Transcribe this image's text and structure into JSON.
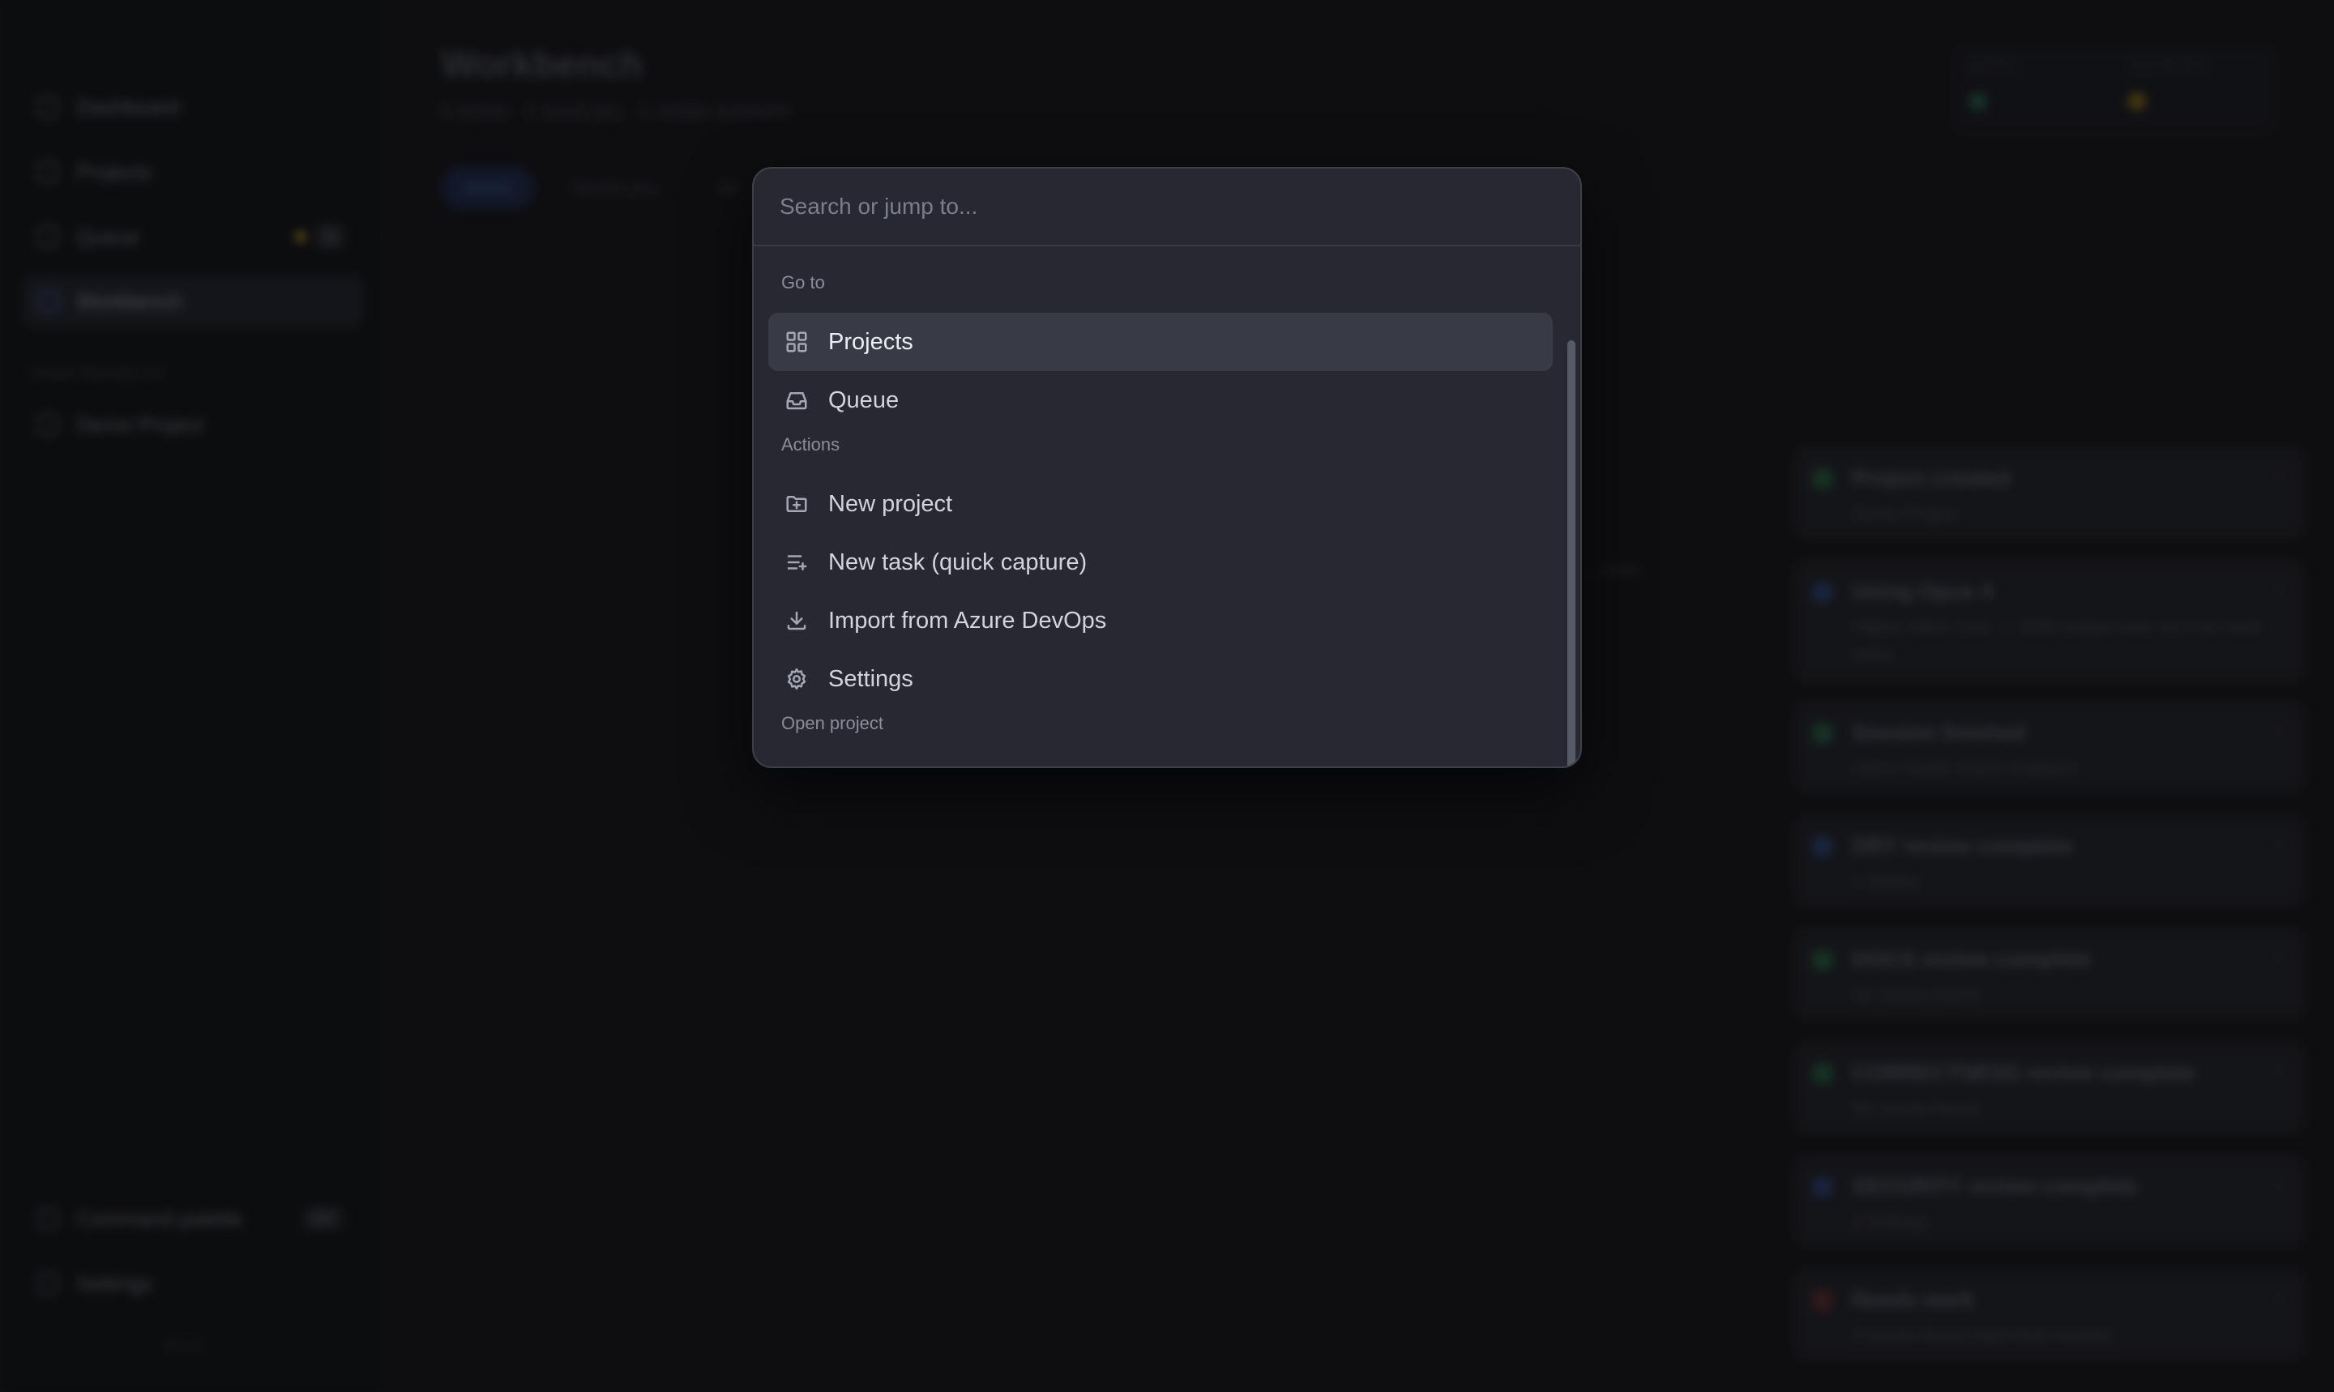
{
  "sidebar": {
    "items": [
      {
        "label": "Dashboard"
      },
      {
        "label": "Projects"
      },
      {
        "label": "Queue",
        "count": "3"
      },
      {
        "label": "Workbench"
      }
    ],
    "section_label": "YOUR PROJECTS",
    "projects": [
      {
        "label": "Demo Project"
      }
    ],
    "bottom": [
      {
        "label": "Command palette",
        "shortcut": "⌘K"
      },
      {
        "label": "Settings"
      }
    ],
    "version": "v0.1.0"
  },
  "main": {
    "title": "Workbench",
    "subtitle": "0 active · 1 need you · 1 visible sessions",
    "filters": [
      "Active",
      "Needs you",
      "All"
    ],
    "stats": [
      {
        "label": "ACTIVE",
        "color": "#1e4d3c"
      },
      {
        "label": "NEEDS YOU",
        "color": "#6a5216"
      }
    ],
    "hint": "...here."
  },
  "notifications": [
    {
      "title": "Project created",
      "body": "Demo Project",
      "status_color": "#1f4a33"
    },
    {
      "title": "Using Opus 4",
      "body": "Higher token cost — 2048 output max; try it on hard tasks",
      "status_color": "#22345c"
    },
    {
      "title": "Session finished",
      "body": "Add a health check endpoint",
      "status_color": "#1f4a33"
    },
    {
      "title": "DRY review complete",
      "body": "1 finding",
      "status_color": "#22345c"
    },
    {
      "title": "DOCS review complete",
      "body": "No issues found",
      "status_color": "#1f4a33"
    },
    {
      "title": "CORRECTNESS review complete",
      "body": "No issues found",
      "status_color": "#1f4a33"
    },
    {
      "title": "SECURITY review complete",
      "body": "2 findings",
      "status_color": "#22345c"
    },
    {
      "title": "Needs work",
      "body": "3 issues found (fight-final review)",
      "status_color": "#4a2424"
    }
  ],
  "palette": {
    "search_placeholder": "Search or jump to...",
    "groups": [
      {
        "label": "Go to",
        "items": [
          {
            "label": "Projects",
            "icon": "grid-icon",
            "selected": true
          },
          {
            "label": "Queue",
            "icon": "inbox-icon"
          }
        ]
      },
      {
        "label": "Actions",
        "items": [
          {
            "label": "New project",
            "icon": "folder-plus-icon"
          },
          {
            "label": "New task (quick capture)",
            "icon": "list-plus-icon"
          },
          {
            "label": "Import from Azure DevOps",
            "icon": "download-icon"
          },
          {
            "label": "Settings",
            "icon": "gear-icon"
          }
        ]
      },
      {
        "label": "Open project",
        "items": []
      }
    ]
  }
}
